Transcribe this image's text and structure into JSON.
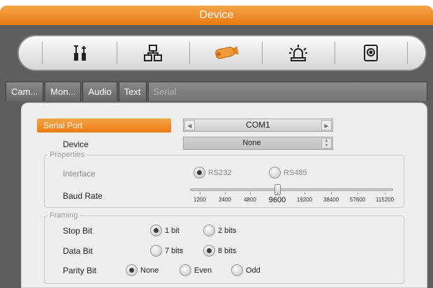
{
  "window": {
    "title": "Device"
  },
  "toolbar": {
    "icons": [
      {
        "name": "tools-icon",
        "glyph": "⚒"
      },
      {
        "name": "network-icon",
        "glyph": "品"
      },
      {
        "name": "camera-icon",
        "glyph": ""
      },
      {
        "name": "alarm-icon",
        "glyph": "⚠"
      },
      {
        "name": "storage-icon",
        "glyph": "◙"
      }
    ],
    "active_index": 2
  },
  "tabs": [
    "Cam...",
    "Mon...",
    "Audio",
    "Text",
    "Serial"
  ],
  "active_tab": "Serial",
  "serial_port": {
    "label": "Serial Port",
    "value": "COM1"
  },
  "device": {
    "label": "Device",
    "value": "None"
  },
  "properties": {
    "legend": "Properties",
    "interface_label": "Interface",
    "interface_options": [
      "RS232",
      "RS485"
    ],
    "interface_selected": "RS232",
    "baud_label": "Baud Rate",
    "baud_ticks": [
      "1200",
      "2400",
      "4800",
      "9600",
      "19200",
      "38400",
      "57600",
      "115200"
    ],
    "baud_selected": "9600"
  },
  "framing": {
    "legend": "Framing",
    "stop_label": "Stop Bit",
    "stop_options": [
      "1 bit",
      "2 bits"
    ],
    "stop_selected": "1 bit",
    "data_label": "Data Bit",
    "data_options": [
      "7 bits",
      "8 bits"
    ],
    "data_selected": "8 bits",
    "parity_label": "Parity Bit",
    "parity_options": [
      "None",
      "Even",
      "Odd"
    ],
    "parity_selected": "None"
  },
  "colors": {
    "accent": "#ea7a12",
    "frame": "#5e5e5e"
  }
}
